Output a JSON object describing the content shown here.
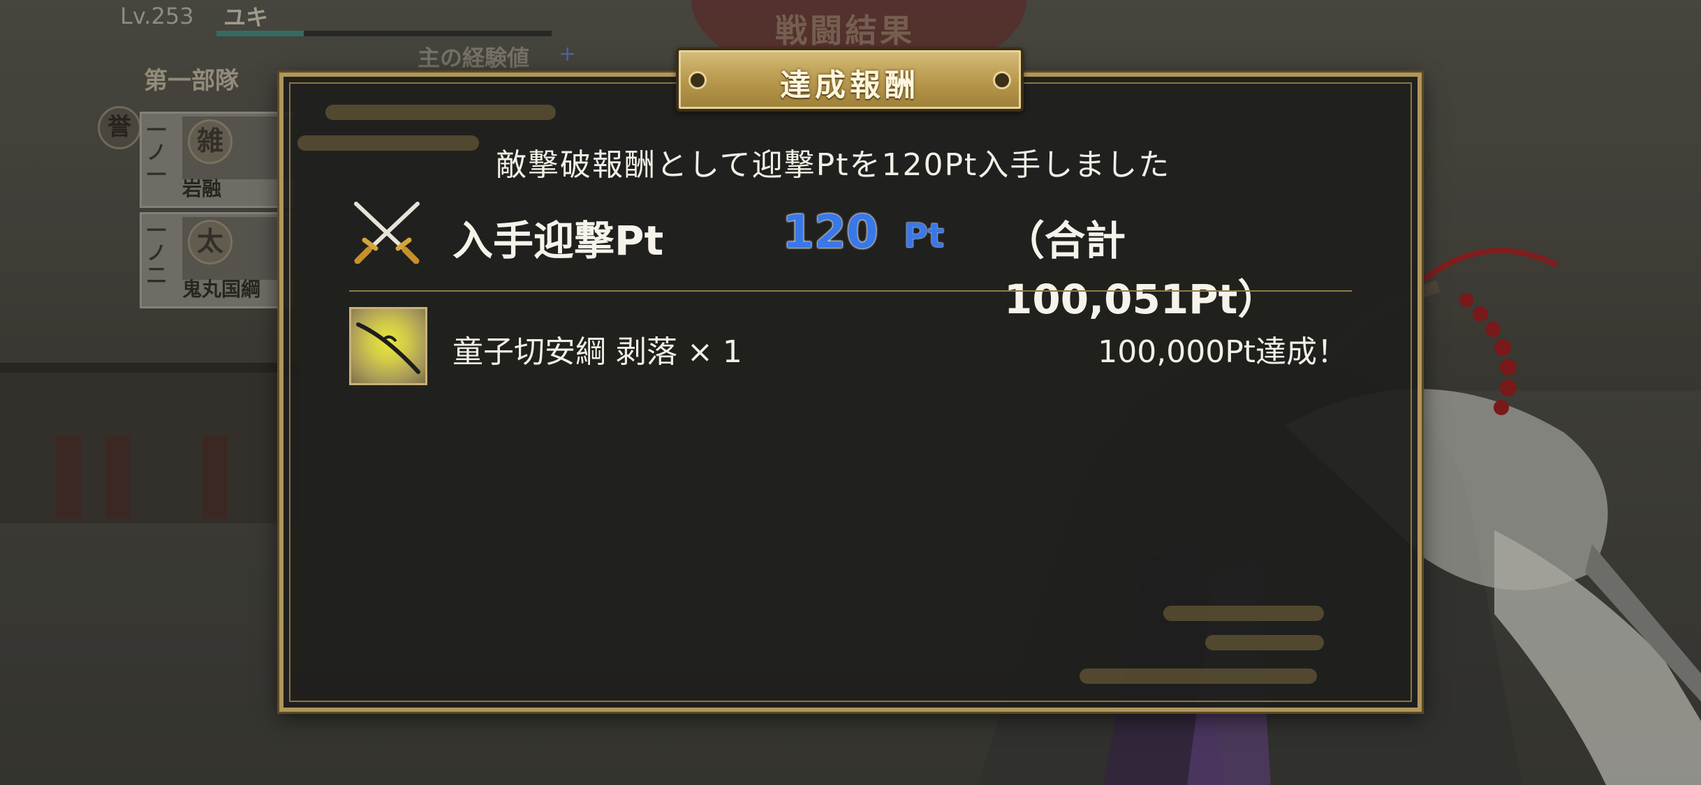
{
  "background": {
    "player_level": "Lv.253",
    "player_name": "ユキ",
    "level_progress": 0.26,
    "battle_result_title": "戦闘結果",
    "exp_label": "主の経験値",
    "exp_plus": "+",
    "team_name": "第一部隊",
    "medal": "誉",
    "units": [
      {
        "slot": "一ノ一",
        "rank": "雑",
        "name": "岩融"
      },
      {
        "slot": "一ノ二",
        "rank": "太",
        "name": "鬼丸国綱"
      }
    ]
  },
  "dialog": {
    "title": "達成報酬",
    "message": "敵撃破報酬として迎撃Ptを120Pt入手しました",
    "points": {
      "icon": "crossed-swords-icon",
      "label": "入手迎撃Pt",
      "value": "120",
      "unit": "Pt",
      "total": "（合計100,051Pt）"
    },
    "reward": {
      "icon": "sword-item-icon",
      "name": "童子切安綱 剥落 × 1",
      "status": "100,000Pt達成！"
    }
  },
  "colors": {
    "gold": "#b0965a",
    "accent_blue": "#3a78e8",
    "panel_bg": "#1e1e1c"
  }
}
